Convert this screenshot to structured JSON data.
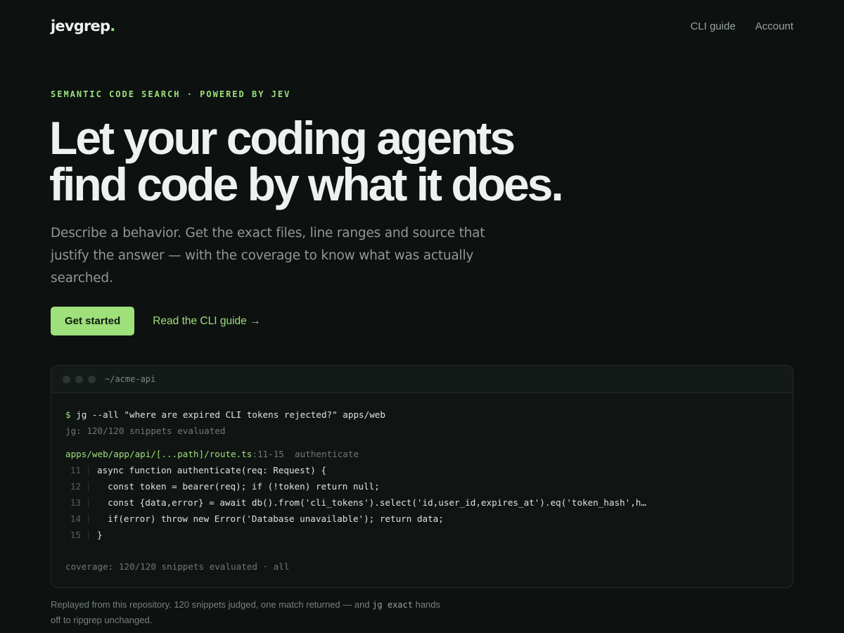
{
  "nav": {
    "logo": "jevgrep",
    "logo_dot": ".",
    "links": [
      "CLI guide",
      "Account"
    ]
  },
  "hero": {
    "eyebrow": "SEMANTIC CODE SEARCH · POWERED BY JEV",
    "title_line1": "Let your coding agents",
    "title_line2": "find code by what it does.",
    "subtitle": "Describe a behavior. Get the exact files, line ranges and source that justify the answer — with the coverage to know what was actually searched.",
    "primary_cta": "Get started",
    "secondary_cta": "Read the CLI guide →"
  },
  "terminal": {
    "path": "~/acme-api",
    "prompt": "$",
    "command": "jg --all \"where are expired CLI tokens rejected?\" apps/web",
    "status": "jg: 120/120 snippets evaluated",
    "result_file": "apps/web/app/api/[...path]/route.ts",
    "result_range": ":11-15",
    "result_symbol": "authenticate",
    "code_lines": [
      {
        "num": "11",
        "text": "async function authenticate(req: Request) {"
      },
      {
        "num": "12",
        "text": "  const token = bearer(req); if (!token) return null;"
      },
      {
        "num": "13",
        "text": "  const {data,error} = await db().from('cli_tokens').select('id,user_id,expires_at').eq('token_hash',h…"
      },
      {
        "num": "14",
        "text": "  if(error) throw new Error('Database unavailable'); return data;"
      },
      {
        "num": "15",
        "text": "}"
      }
    ],
    "coverage": "coverage: 120/120 snippets evaluated · all"
  },
  "footnote": {
    "text_before": "Replayed from this repository. 120 snippets judged, one match returned — and ",
    "code": "jg exact",
    "text_after": " hands off to ripgrep unchanged."
  },
  "colors": {
    "accent": "#9ee07a",
    "background": "#0d1110"
  }
}
